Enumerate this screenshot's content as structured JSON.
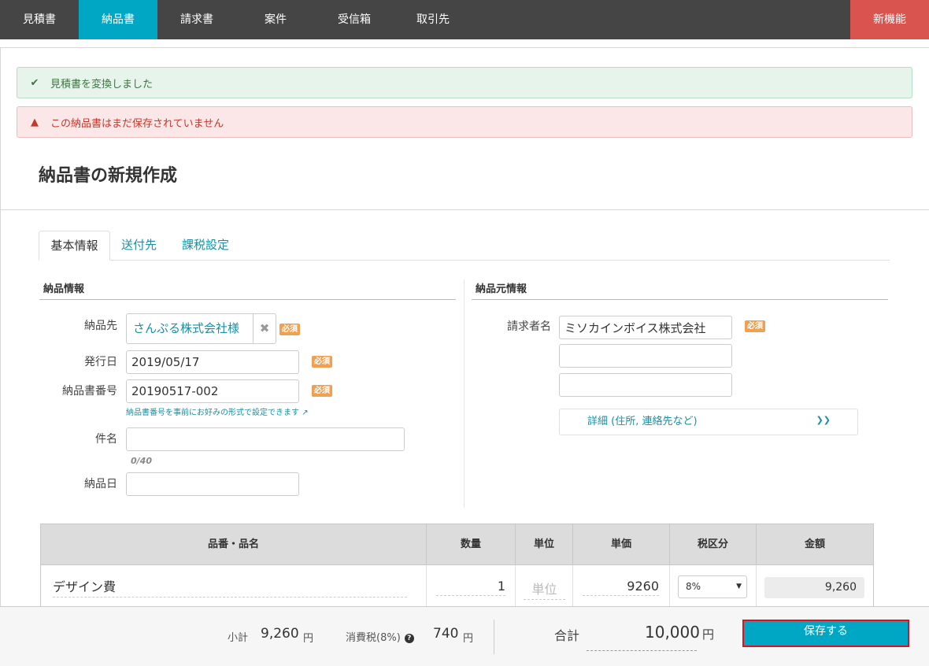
{
  "nav": {
    "tabs": [
      "見積書",
      "納品書",
      "請求書",
      "案件",
      "受信箱",
      "取引先"
    ],
    "new_feature": "新機能"
  },
  "alerts": {
    "success": "見積書を変換しました",
    "danger": "この納品書はまだ保存されていません"
  },
  "page_title": "納品書の新規作成",
  "tabs": {
    "basic": "基本情報",
    "send_to": "送付先",
    "tax": "課税設定"
  },
  "delivery_info": {
    "heading": "納品情報",
    "client_label": "納品先",
    "client_value": "さんぷる株式会社様",
    "issue_date_label": "発行日",
    "issue_date_value": "2019/05/17",
    "number_label": "納品書番号",
    "number_value": "20190517-002",
    "number_hint": "納品書番号を事前にお好みの形式で設定できます",
    "subject_label": "件名",
    "subject_value": "",
    "subject_counter": "0/40",
    "delivery_date_label": "納品日",
    "delivery_date_value": "",
    "required": "必須"
  },
  "sender_info": {
    "heading": "納品元情報",
    "requester_label": "請求者名",
    "requester_value": "ミソカインボイス株式会社",
    "line2": "",
    "line3": "",
    "detail_label": "詳細 (住所, 連絡先など)"
  },
  "table": {
    "headers": [
      "品番・品名",
      "数量",
      "単位",
      "単価",
      "税区分",
      "金額"
    ],
    "rows": [
      {
        "name": "デザイン費",
        "qty": "1",
        "unit_placeholder": "単位",
        "price": "9260",
        "tax": "8%",
        "amount": "9,260"
      }
    ]
  },
  "footer": {
    "subtotal_label": "小計",
    "subtotal_value": "9,260",
    "tax_label": "消費税(8%)",
    "tax_value": "740",
    "total_label": "合計",
    "total_value": "10,000",
    "yen": "円",
    "save_button": "保存する"
  },
  "colors": {
    "accent": "#00a7c4",
    "danger": "#d9534f",
    "nav_bg": "#454545",
    "required": "#f0a050"
  }
}
